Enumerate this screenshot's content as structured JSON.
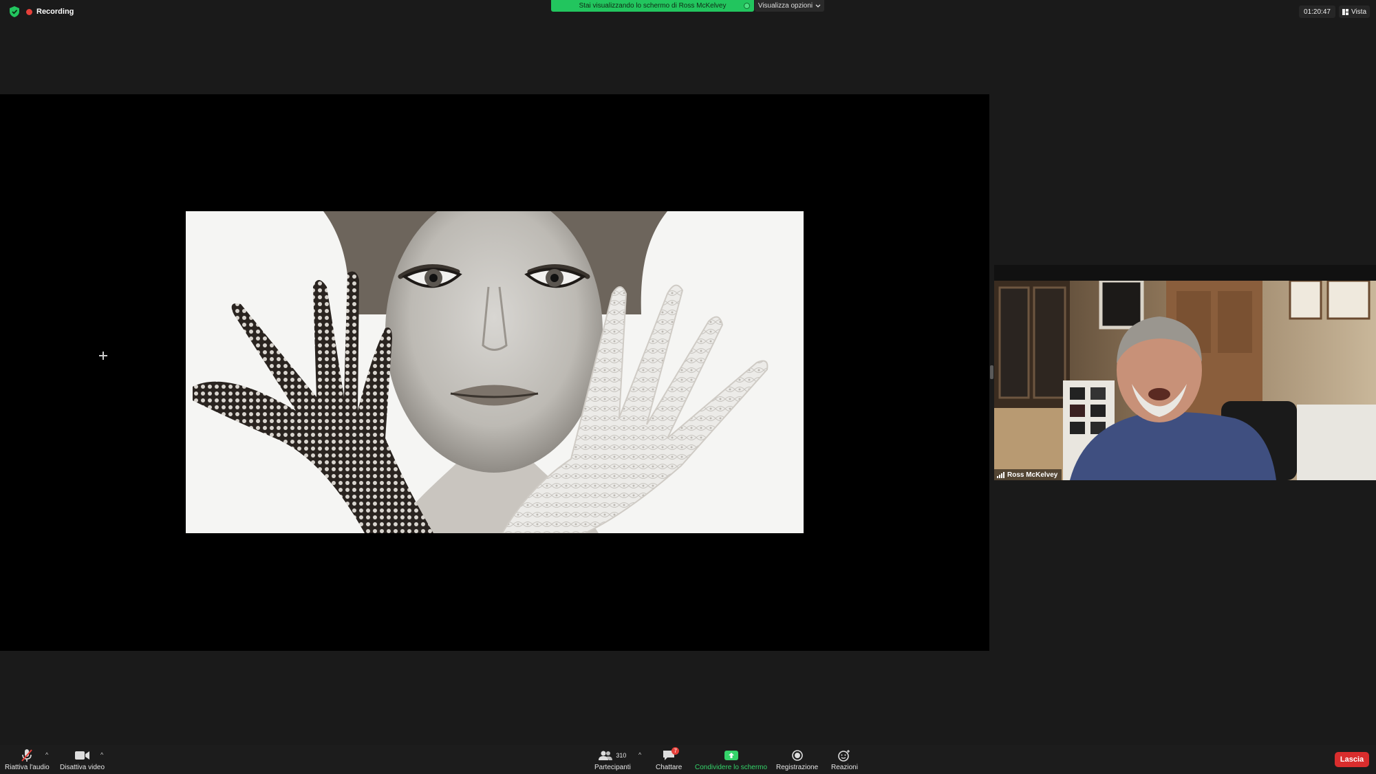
{
  "top": {
    "recording_label": "Recording",
    "viewing_banner": "Stai visualizzando lo schermo di Ross McKelvey",
    "view_options_label": "Visualizza opzioni",
    "meeting_timer": "01:20:47",
    "view_button_label": "Vista"
  },
  "participant": {
    "name": "Ross McKelvey"
  },
  "toolbar": {
    "unmute_label": "Riattiva l'audio",
    "stop_video_label": "Disattiva video",
    "participants_label": "Partecipanti",
    "participants_count": "310",
    "chat_label": "Chattare",
    "chat_badge": "7",
    "share_label": "Condividere lo schermo",
    "record_label": "Registrazione",
    "reactions_label": "Reazioni",
    "leave_label": "Lascia"
  },
  "colors": {
    "background": "#1a1a1a",
    "banner_green": "#22c55e",
    "share_green": "#35d46a",
    "leave_red": "#d92d2d",
    "recording_red": "#e5403a"
  },
  "icons": [
    "shield-icon",
    "recording-dot-icon",
    "chevron-down-icon",
    "layout-icon",
    "muted-mic-icon",
    "video-camera-icon",
    "participants-icon",
    "chat-icon",
    "share-screen-icon",
    "record-icon",
    "reactions-icon",
    "signal-icon",
    "crosshair-cursor-icon"
  ]
}
